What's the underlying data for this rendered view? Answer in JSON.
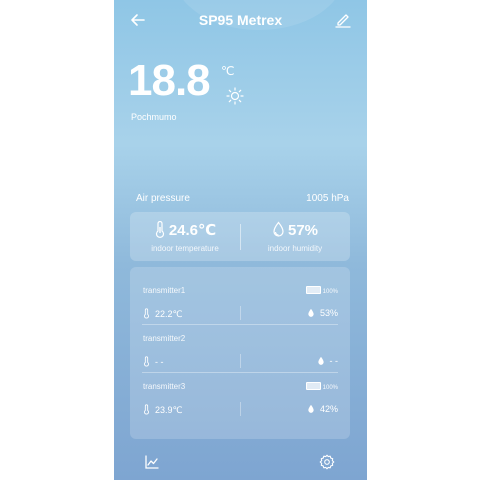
{
  "header": {
    "title": "SP95 Metrex"
  },
  "current": {
    "temperature": "18.8",
    "unit": "℃",
    "location": "Pochmumo"
  },
  "pressure": {
    "label": "Air pressure",
    "value": "1005 hPa"
  },
  "indoor": {
    "temperature": "24.6℃",
    "temperature_label": "indoor temperature",
    "humidity": "57%",
    "humidity_label": "indoor humidity"
  },
  "transmitters": [
    {
      "name": "transmitter1",
      "battery": "100%",
      "temperature": "22.2℃",
      "humidity": "53%"
    },
    {
      "name": "transmitter2",
      "battery": "",
      "temperature": "- -",
      "humidity": "- -"
    },
    {
      "name": "transmitter3",
      "battery": "100%",
      "temperature": "23.9℃",
      "humidity": "42%"
    }
  ],
  "icons": [
    "back-arrow-icon",
    "edit-icon",
    "sun-icon",
    "thermometer-icon",
    "droplet-icon",
    "battery-icon",
    "chart-icon",
    "gear-icon"
  ],
  "colors": {
    "background_top": "#8fc6e6",
    "background_bottom": "#7ea5d1",
    "text": "#ffffff"
  }
}
